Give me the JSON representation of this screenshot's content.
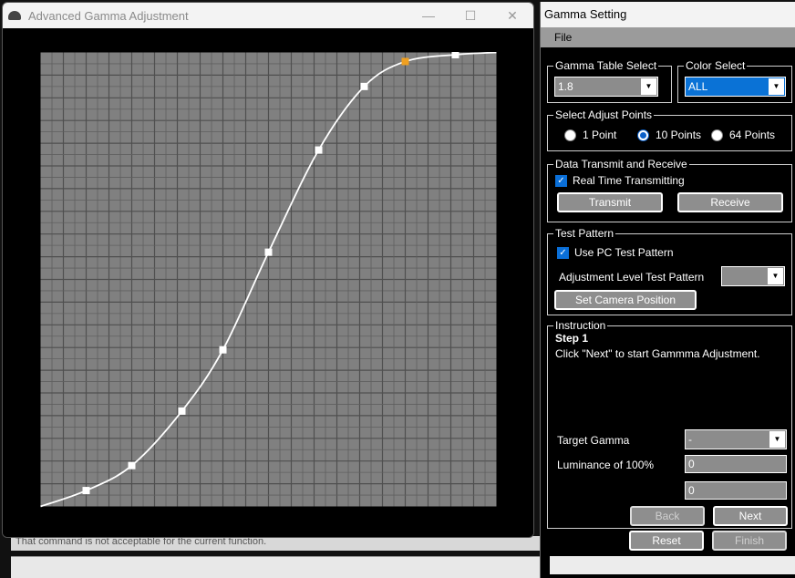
{
  "background": {
    "status_message": "That command is not acceptable for the current function."
  },
  "adv_window": {
    "title": "Advanced Gamma Adjustment",
    "controls": {
      "minimize": "—",
      "maximize": "☐",
      "close": "✕"
    }
  },
  "gamma_curve": {
    "type": "line",
    "xlim": [
      0,
      1
    ],
    "ylim": [
      0,
      1
    ],
    "grid": true,
    "grid_divisions": 20,
    "points": [
      [
        0.0,
        0.0
      ],
      [
        0.1,
        0.035
      ],
      [
        0.2,
        0.09
      ],
      [
        0.31,
        0.21
      ],
      [
        0.4,
        0.345
      ],
      [
        0.5,
        0.56
      ],
      [
        0.61,
        0.785
      ],
      [
        0.71,
        0.925
      ],
      [
        0.8,
        0.98
      ],
      [
        0.91,
        0.995
      ],
      [
        1.0,
        1.0
      ]
    ],
    "selected_index": 8,
    "colors": {
      "curve": "#ffffff",
      "marker": "#ffffff",
      "selected": "#f0a020",
      "plot_bg": "#808080",
      "grid": "#5f5f5f"
    }
  },
  "gs_window": {
    "title": "Gamma Setting",
    "menu_file": "File",
    "gamma_table": {
      "label": "Gamma Table Select",
      "value": "1.8"
    },
    "color_select": {
      "label": "Color Select",
      "value": "ALL"
    },
    "adjust_points": {
      "label": "Select Adjust Points",
      "options": [
        "1 Point",
        "10 Points",
        "64 Points"
      ],
      "selected": "10 Points"
    },
    "data_tx": {
      "label": "Data Transmit and Receive",
      "realtime_label": "Real Time Transmitting",
      "transmit": "Transmit",
      "receive": "Receive"
    },
    "test_pattern": {
      "label": "Test Pattern",
      "use_pc_label": "Use PC Test Pattern",
      "level_label": "Adjustment Level Test Pattern",
      "level_value": "",
      "set_camera": "Set Camera Position"
    },
    "instruction": {
      "label": "Instruction",
      "step": "Step  1",
      "text": "Click \"Next\" to start Gammma Adjustment.",
      "target_gamma_label": "Target Gamma",
      "target_gamma_value": "-",
      "luminance_label": "Luminance of 100%",
      "luminance_value": "0",
      "value2": "0",
      "back": "Back",
      "next": "Next",
      "reset": "Reset",
      "finish": "Finish"
    }
  }
}
